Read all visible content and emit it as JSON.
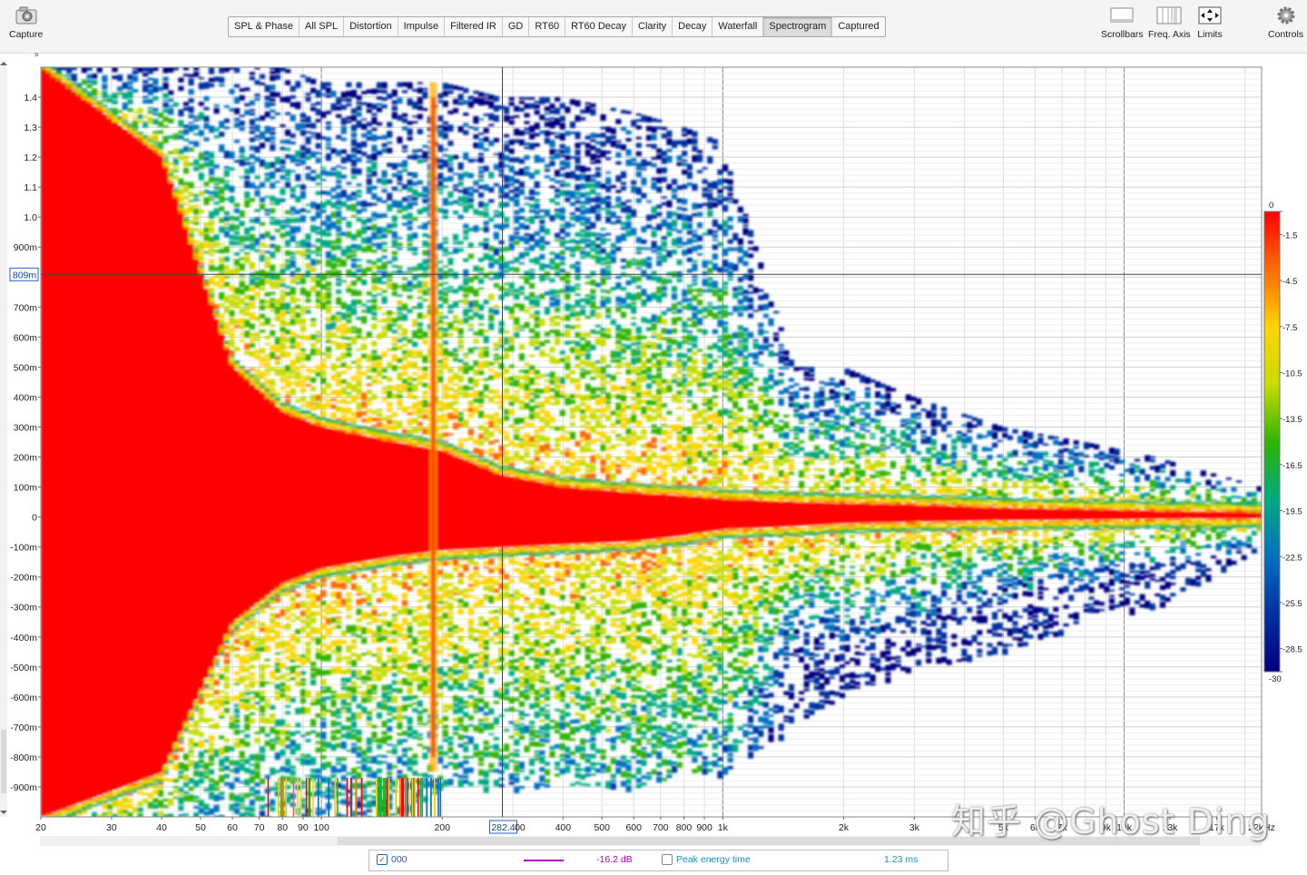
{
  "toolbar": {
    "capture_label": "Capture",
    "tabs": [
      "SPL & Phase",
      "All SPL",
      "Distortion",
      "Impulse",
      "Filtered IR",
      "GD",
      "RT60",
      "RT60 Decay",
      "Clarity",
      "Decay",
      "Waterfall",
      "Spectrogram",
      "Captured"
    ],
    "active_tab": "Spectrogram",
    "scrollbars_label": "Scrollbars",
    "freq_axis_label": "Freq. Axis",
    "limits_label": "Limits",
    "controls_label": "Controls"
  },
  "legend": {
    "measurement_name": "000",
    "level": "-16.2 dB",
    "peak_energy_label": "Peak energy time",
    "peak_energy_value": "1.23 ms",
    "peak_energy_checked": false,
    "measurement_checked": true,
    "series_color": "#b000c0"
  },
  "watermark": "知乎 @Ghost Ding",
  "chart_data": {
    "type": "heatmap",
    "title": "",
    "y_unit": "s",
    "x_scale": "log",
    "xlim": [
      20,
      22000
    ],
    "ylim": [
      -1.0,
      1.5
    ],
    "x_ticks": [
      {
        "v": 20,
        "t": "20"
      },
      {
        "v": 30,
        "t": "30"
      },
      {
        "v": 40,
        "t": "40"
      },
      {
        "v": 50,
        "t": "50"
      },
      {
        "v": 60,
        "t": "60"
      },
      {
        "v": 70,
        "t": "70"
      },
      {
        "v": 80,
        "t": "80"
      },
      {
        "v": 90,
        "t": "90"
      },
      {
        "v": 100,
        "t": "100"
      },
      {
        "v": 200,
        "t": "200"
      },
      {
        "v": 300,
        "t": "300"
      },
      {
        "v": 400,
        "t": "400"
      },
      {
        "v": 500,
        "t": "500"
      },
      {
        "v": 600,
        "t": "600"
      },
      {
        "v": 700,
        "t": "700"
      },
      {
        "v": 800,
        "t": "800"
      },
      {
        "v": 900,
        "t": "900"
      },
      {
        "v": 1000,
        "t": "1k"
      },
      {
        "v": 2000,
        "t": "2k"
      },
      {
        "v": 3000,
        "t": "3k"
      },
      {
        "v": 5000,
        "t": "5k"
      },
      {
        "v": 6000,
        "t": "6k"
      },
      {
        "v": 7000,
        "t": "7k"
      },
      {
        "v": 9000,
        "t": "9k"
      },
      {
        "v": 10000,
        "t": "10k"
      },
      {
        "v": 13000,
        "t": "13k"
      },
      {
        "v": 17000,
        "t": "17k"
      },
      {
        "v": 22000,
        "t": "22kHz"
      }
    ],
    "y_ticks": [
      {
        "v": 1.4,
        "t": "1.4"
      },
      {
        "v": 1.3,
        "t": "1.3"
      },
      {
        "v": 1.2,
        "t": "1.2"
      },
      {
        "v": 1.1,
        "t": "1.1"
      },
      {
        "v": 1.0,
        "t": "1.0"
      },
      {
        "v": 0.9,
        "t": "900m"
      },
      {
        "v": 0.7,
        "t": "700m"
      },
      {
        "v": 0.6,
        "t": "600m"
      },
      {
        "v": 0.5,
        "t": "500m"
      },
      {
        "v": 0.4,
        "t": "400m"
      },
      {
        "v": 0.3,
        "t": "300m"
      },
      {
        "v": 0.2,
        "t": "200m"
      },
      {
        "v": 0.1,
        "t": "100m"
      },
      {
        "v": 0,
        "t": "0"
      },
      {
        "v": -0.1,
        "t": "-100m"
      },
      {
        "v": -0.2,
        "t": "-200m"
      },
      {
        "v": -0.3,
        "t": "-300m"
      },
      {
        "v": -0.4,
        "t": "-400m"
      },
      {
        "v": -0.5,
        "t": "-500m"
      },
      {
        "v": -0.6,
        "t": "-600m"
      },
      {
        "v": -0.7,
        "t": "-700m"
      },
      {
        "v": -0.8,
        "t": "-800m"
      },
      {
        "v": -0.9,
        "t": "-900m"
      }
    ],
    "cursor": {
      "x": 282.4,
      "x_label": "282.4",
      "y": 0.809,
      "y_label": "809m"
    },
    "colorbar": {
      "unit_ticks": [
        {
          "v": 0,
          "t": "0"
        },
        {
          "v": -1.5,
          "t": "-1.5"
        },
        {
          "v": -4.5,
          "t": "-4.5"
        },
        {
          "v": -7.5,
          "t": "-7.5"
        },
        {
          "v": -10.5,
          "t": "-10.5"
        },
        {
          "v": -13.5,
          "t": "-13.5"
        },
        {
          "v": -16.5,
          "t": "-16.5"
        },
        {
          "v": -19.5,
          "t": "-19.5"
        },
        {
          "v": -22.5,
          "t": "-22.5"
        },
        {
          "v": -25.5,
          "t": "-25.5"
        },
        {
          "v": -28.5,
          "t": "-28.5"
        },
        {
          "v": -30,
          "t": "-30"
        }
      ],
      "range": [
        -30,
        0
      ],
      "colors": [
        "#ff0000",
        "#ff6a00",
        "#ffd400",
        "#c8dc00",
        "#30b400",
        "#00aa80",
        "#0070c0",
        "#0030a0",
        "#000080"
      ]
    },
    "decay_profile": {
      "freqs": [
        20,
        40,
        60,
        80,
        100,
        150,
        200,
        280,
        400,
        600,
        800,
        1000,
        1500,
        2000,
        3000,
        5000,
        8000,
        12000,
        22000
      ],
      "red_upper_s": [
        1.5,
        1.2,
        0.5,
        0.35,
        0.3,
        0.25,
        0.22,
        0.14,
        0.1,
        0.08,
        0.07,
        0.06,
        0.05,
        0.045,
        0.04,
        0.03,
        0.025,
        0.02,
        0.015
      ],
      "red_lower_s": [
        -1.0,
        -0.85,
        -0.35,
        -0.22,
        -0.17,
        -0.13,
        -0.11,
        -0.1,
        -0.09,
        -0.08,
        -0.06,
        -0.04,
        -0.03,
        -0.02,
        -0.015,
        -0.01,
        -0.008,
        -0.005,
        -0.004
      ],
      "speckle_upper_s": [
        1.5,
        1.5,
        1.5,
        1.5,
        1.45,
        1.45,
        1.45,
        1.4,
        1.4,
        1.35,
        1.3,
        1.25,
        0.5,
        0.5,
        0.4,
        0.3,
        0.25,
        0.2,
        0.1
      ],
      "speckle_lower_s": [
        -1.0,
        -1.0,
        -1.0,
        -1.0,
        -1.0,
        -1.0,
        -0.9,
        -0.9,
        -0.9,
        -0.9,
        -0.85,
        -0.85,
        -0.7,
        -0.6,
        -0.5,
        -0.45,
        -0.35,
        -0.3,
        -0.1
      ]
    }
  }
}
